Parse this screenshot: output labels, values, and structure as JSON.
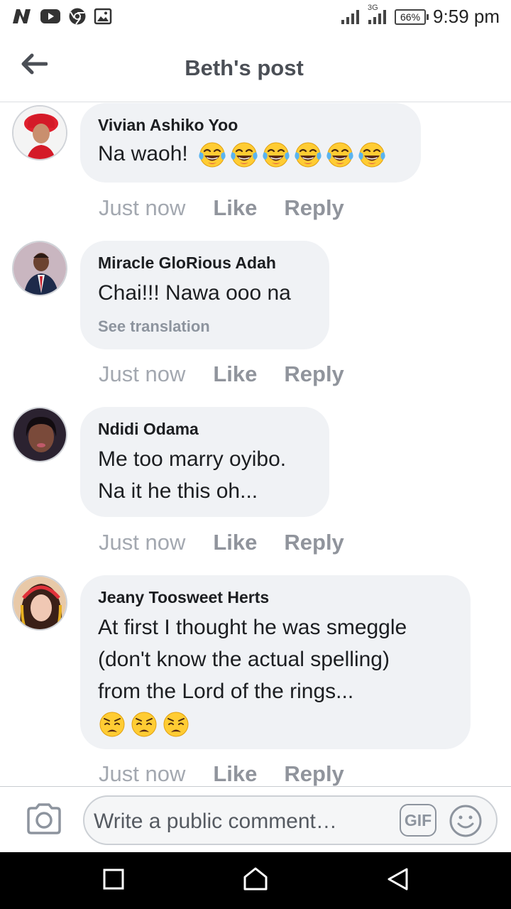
{
  "status_bar": {
    "time": "9:59 pm",
    "battery": "66%",
    "network": "3G",
    "icons": [
      "n-icon",
      "youtube-icon",
      "chrome-icon",
      "gallery-icon",
      "signal-icon",
      "signal-3g-icon"
    ]
  },
  "header": {
    "title": "Beth's post",
    "back_icon": "arrow-left-icon"
  },
  "comments": [
    {
      "name": "Vivian Ashiko Yoo",
      "text": "Na waoh!",
      "emoji": "face-with-tears-of-joy",
      "emoji_count": 6,
      "time": "Just now",
      "like": "Like",
      "reply": "Reply"
    },
    {
      "name": "Miracle GloRious Adah",
      "text": "Chai!!! Nawa ooo na",
      "translation": "See translation",
      "time": "Just now",
      "like": "Like",
      "reply": "Reply"
    },
    {
      "name": "Ndidi Odama",
      "text_lines": [
        "Me too marry oyibo.",
        "Na it he this oh..."
      ],
      "time": "Just now",
      "like": "Like",
      "reply": "Reply"
    },
    {
      "name": "Jeany Toosweet Herts",
      "text_lines": [
        "At first I thought he was smeggle",
        "(don't know the actual spelling)",
        "from the Lord of the rings..."
      ],
      "emoji": "weary-face",
      "emoji_count": 3,
      "time": "Just now",
      "like": "Like",
      "reply": "Reply"
    }
  ],
  "composer": {
    "placeholder": "Write a public comment…",
    "gif_label": "GIF",
    "camera_icon": "camera-icon",
    "emoji_icon": "smiley-icon"
  },
  "navbar": {
    "icons": [
      "recents-icon",
      "home-icon",
      "back-icon"
    ]
  },
  "colors": {
    "bubble": "#f0f2f5",
    "meta_text": "#90949c",
    "title_text": "#4b4f56",
    "navbar": "#000000"
  }
}
